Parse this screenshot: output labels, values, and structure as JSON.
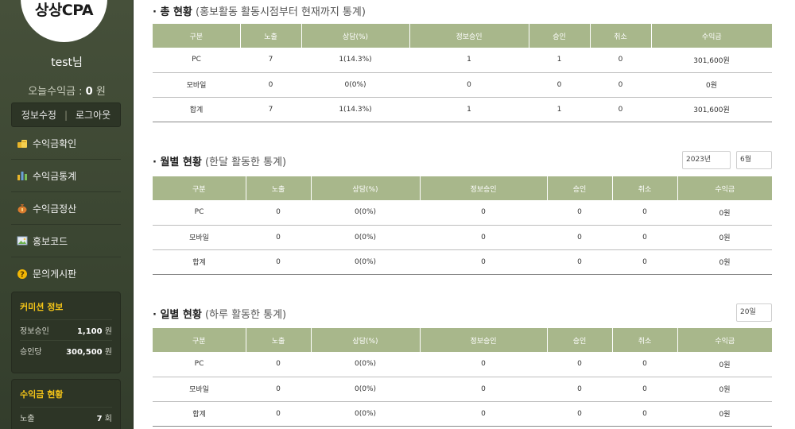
{
  "sidebar": {
    "logo": "상상CPA",
    "username": "test님",
    "today_label": "오늘수익금 : ",
    "today_value": "0",
    "today_unit": " 원",
    "edit_label": "정보수정",
    "separator": "|",
    "logout_label": "로그아웃",
    "menu": [
      {
        "label": "수익금확인",
        "icon": "coins-icon"
      },
      {
        "label": "수익금통계",
        "icon": "bar-chart-icon"
      },
      {
        "label": "수익금정산",
        "icon": "money-bag-icon"
      },
      {
        "label": "홍보코드",
        "icon": "image-code-icon"
      },
      {
        "label": "문의게시판",
        "icon": "question-icon"
      }
    ],
    "commission": {
      "title": "커미션 정보",
      "rows": [
        {
          "label": "정보승인",
          "value": "1,100",
          "unit": " 원"
        },
        {
          "label": "승인당",
          "value": "300,500",
          "unit": " 원"
        }
      ]
    },
    "earnings": {
      "title": "수익금 현황",
      "rows": [
        {
          "label": "노출",
          "value": "7",
          "unit": " 회"
        }
      ]
    }
  },
  "headers": [
    "구분",
    "노출",
    "상담(%)",
    "정보승인",
    "승인",
    "취소",
    "수익금"
  ],
  "total": {
    "title_bold": "· 총 현황",
    "title_sub": " (홍보활동 활동시점부터 현재까지 통계)",
    "rows": [
      [
        "PC",
        "7",
        "1(14.3%)",
        "1",
        "1",
        "0",
        "301,600원"
      ],
      [
        "모바일",
        "0",
        "0(0%)",
        "0",
        "0",
        "0",
        "0원"
      ],
      [
        "합계",
        "7",
        "1(14.3%)",
        "1",
        "1",
        "0",
        "301,600원"
      ]
    ]
  },
  "monthly": {
    "title_bold": "· 월별 현황",
    "title_sub": " (한달 활동한 통계)",
    "year_select": "2023년",
    "month_select": "6월",
    "rows": [
      [
        "PC",
        "0",
        "0(0%)",
        "0",
        "0",
        "0",
        "0원"
      ],
      [
        "모바일",
        "0",
        "0(0%)",
        "0",
        "0",
        "0",
        "0원"
      ],
      [
        "합계",
        "0",
        "0(0%)",
        "0",
        "0",
        "0",
        "0원"
      ]
    ]
  },
  "daily": {
    "title_bold": "· 일별 현황",
    "title_sub": " (하루 활동한 통계)",
    "day_select": "20일",
    "rows": [
      [
        "PC",
        "0",
        "0(0%)",
        "0",
        "0",
        "0",
        "0원"
      ],
      [
        "모바일",
        "0",
        "0(0%)",
        "0",
        "0",
        "0",
        "0원"
      ],
      [
        "합계",
        "0",
        "0(0%)",
        "0",
        "0",
        "0",
        "0원"
      ]
    ]
  }
}
